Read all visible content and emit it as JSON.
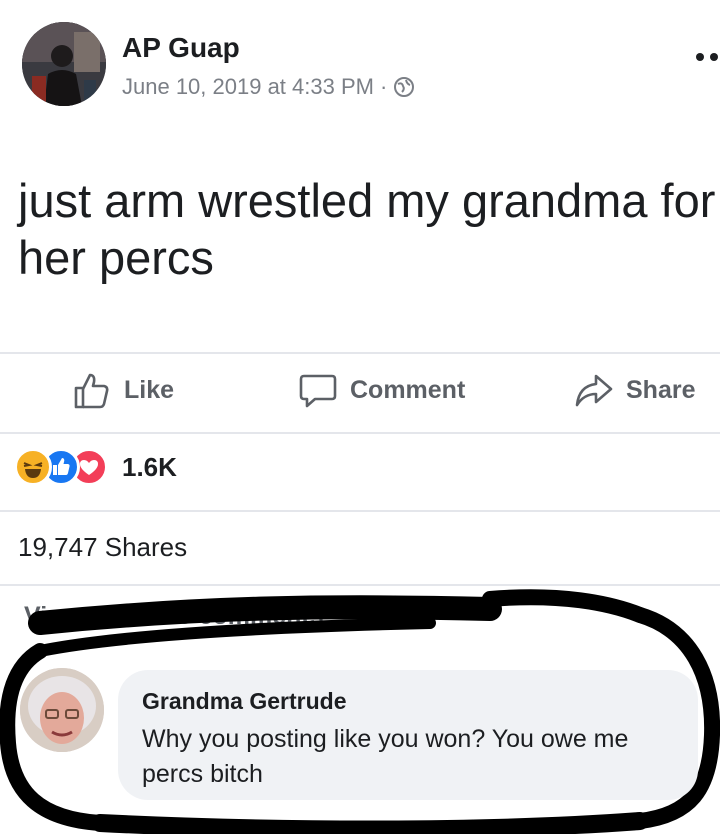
{
  "post": {
    "author": "AP Guap",
    "timestamp": "June 10, 2019 at 4:33 PM",
    "separator": "·",
    "privacy_icon": "globe-icon",
    "more_icon": "more-options-icon",
    "text": "just arm wrestled my grandma for her percs"
  },
  "actions": {
    "like": "Like",
    "comment": "Comment",
    "share": "Share"
  },
  "reactions": {
    "icons": [
      "haha-icon",
      "like-icon",
      "love-icon"
    ],
    "count": "1.6K"
  },
  "shares": {
    "text": "19,747 Shares"
  },
  "comments": {
    "view_previous": "View previous comments",
    "items": [
      {
        "author": "Grandma Gertrude",
        "text": "Why you posting like you won? You owe me percs bitch"
      }
    ]
  },
  "colors": {
    "text_primary": "#1c1e21",
    "text_secondary": "#5c6066",
    "like_blue": "#1877f2",
    "love_red": "#f33e58",
    "haha_yellow": "#f7b125",
    "bubble_bg": "#f0f2f5",
    "marker_black": "#000000"
  }
}
